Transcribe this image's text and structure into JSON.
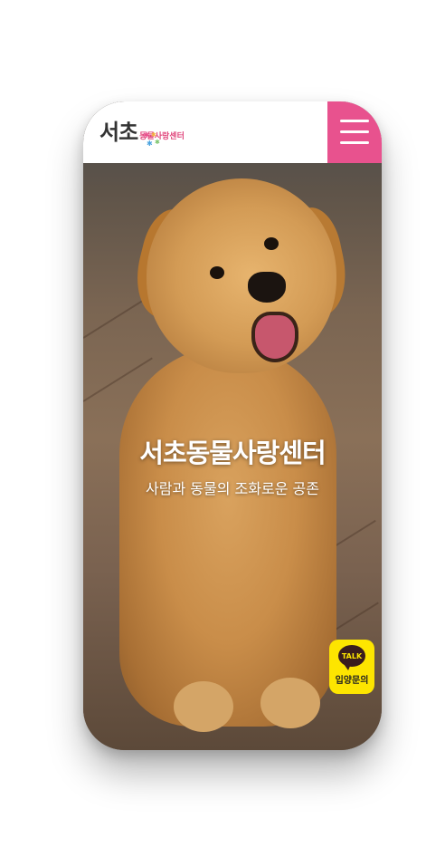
{
  "header": {
    "logo_main": "서초",
    "logo_sub": "동물사랑센터",
    "menu_icon": "hamburger-icon",
    "menu_color": "#e8528e",
    "logo_star_colors": [
      "#e8528e",
      "#f3b23b",
      "#4aa3df",
      "#7bc46b"
    ]
  },
  "hero": {
    "title": "서초동물사랑센터",
    "subtitle": "사람과 동물의 조화로운 공존"
  },
  "kakao": {
    "badge": "TALK",
    "label": "입양문의",
    "color": "#fde500"
  }
}
